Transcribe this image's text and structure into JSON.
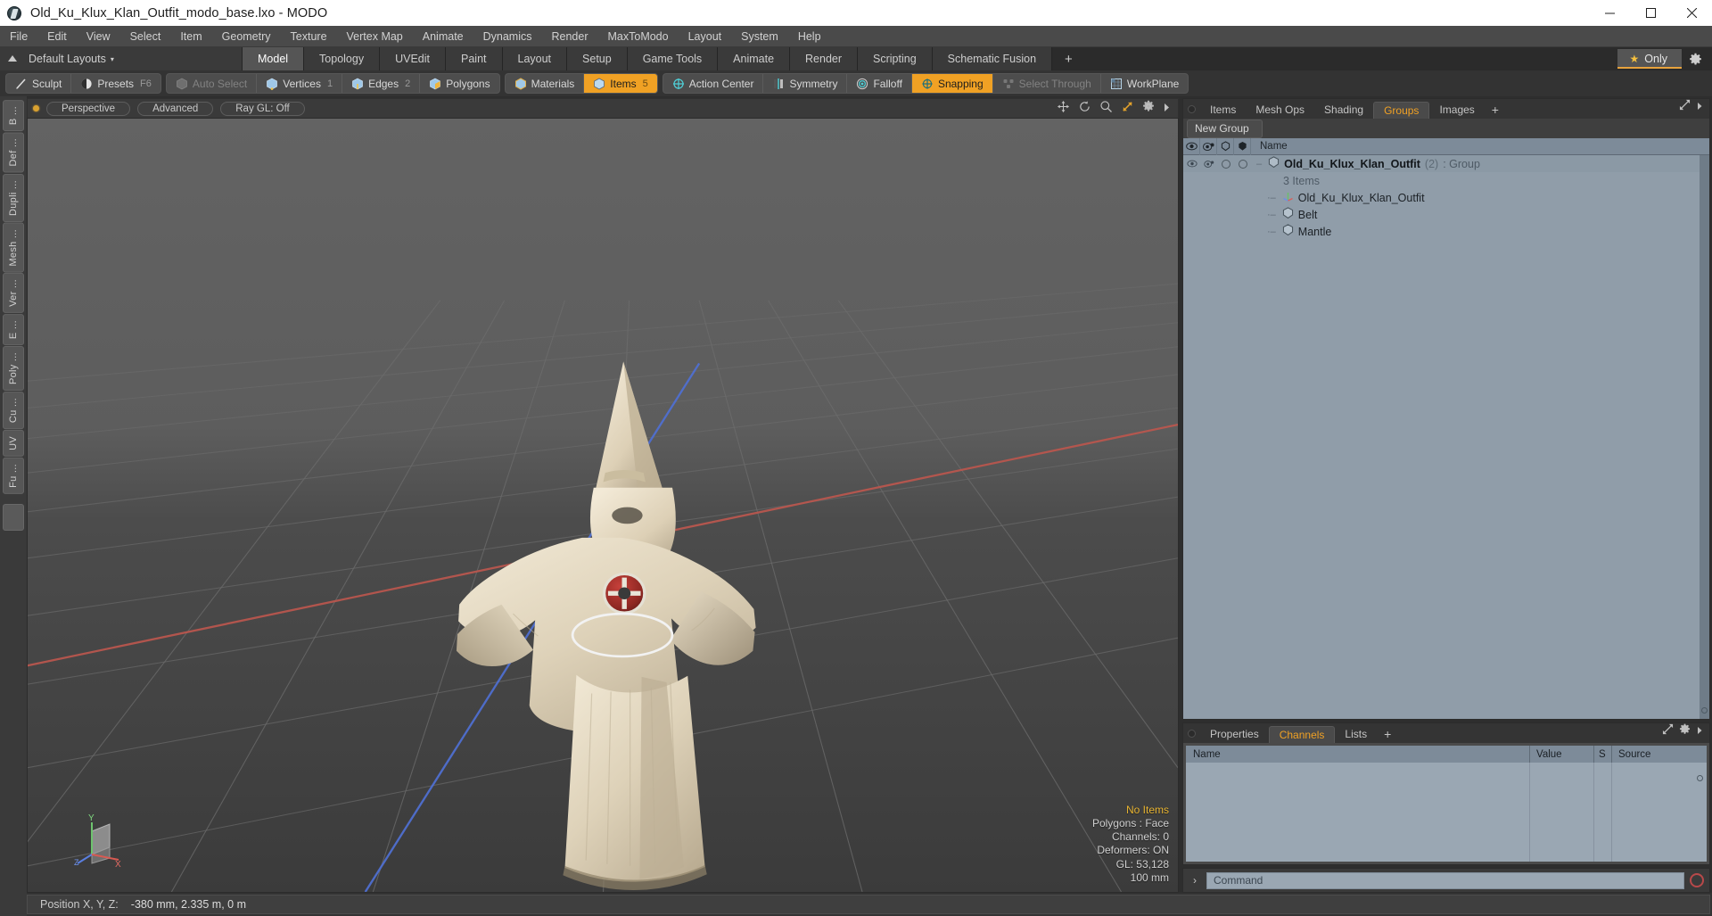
{
  "window": {
    "title": "Old_Ku_Klux_Klan_Outfit_modo_base.lxo - MODO",
    "app_icon": "modo-logo-icon",
    "minimize": "–",
    "maximize": "□",
    "close": "✕"
  },
  "menubar": {
    "items": [
      "File",
      "Edit",
      "View",
      "Select",
      "Item",
      "Geometry",
      "Texture",
      "Vertex Map",
      "Animate",
      "Dynamics",
      "Render",
      "MaxToModo",
      "Layout",
      "System",
      "Help"
    ]
  },
  "layoutbar": {
    "layout_selector": "Default Layouts",
    "caret": "▾",
    "updir_icon": "up-arrow-icon",
    "tabs": [
      {
        "label": "Model",
        "active": true
      },
      {
        "label": "Topology",
        "active": false
      },
      {
        "label": "UVEdit",
        "active": false
      },
      {
        "label": "Paint",
        "active": false
      },
      {
        "label": "Layout",
        "active": false
      },
      {
        "label": "Setup",
        "active": false
      },
      {
        "label": "Game Tools",
        "active": false
      },
      {
        "label": "Animate",
        "active": false
      },
      {
        "label": "Render",
        "active": false
      },
      {
        "label": "Scripting",
        "active": false
      },
      {
        "label": "Schematic Fusion",
        "active": false
      }
    ],
    "add_tab": "+",
    "only_button": "Only",
    "only_star": "★",
    "gear_icon": "gear-icon",
    "accent": "#f0a124"
  },
  "modebar": {
    "groups": [
      {
        "buttons": [
          {
            "label": "Sculpt",
            "icon": "brush-icon",
            "state": "normal",
            "num": ""
          },
          {
            "label": "Presets",
            "icon": "preset-sphere-icon",
            "state": "normal",
            "num": "F6"
          }
        ]
      },
      {
        "buttons": [
          {
            "label": "Auto Select",
            "icon": "cube-gray-icon",
            "state": "disabled",
            "num": ""
          },
          {
            "label": "Vertices",
            "icon": "cube-vertex-icon",
            "state": "normal",
            "num": "1"
          },
          {
            "label": "Edges",
            "icon": "cube-edge-icon",
            "state": "normal",
            "num": "2"
          },
          {
            "label": "Polygons",
            "icon": "cube-poly-icon",
            "state": "normal",
            "num": ""
          }
        ]
      },
      {
        "buttons": [
          {
            "label": "Materials",
            "icon": "cube-material-icon",
            "state": "normal",
            "num": ""
          },
          {
            "label": "Items",
            "icon": "cube-item-icon",
            "state": "active",
            "num": "5"
          }
        ]
      },
      {
        "buttons": [
          {
            "label": "Action Center",
            "icon": "action-center-icon",
            "state": "normal",
            "num": ""
          },
          {
            "label": "Symmetry",
            "icon": "symmetry-icon",
            "state": "normal",
            "num": ""
          },
          {
            "label": "Falloff",
            "icon": "falloff-icon",
            "state": "normal",
            "num": ""
          },
          {
            "label": "Snapping",
            "icon": "snapping-icon",
            "state": "active",
            "num": ""
          },
          {
            "label": "Select Through",
            "icon": "select-through-icon",
            "state": "disabled",
            "num": ""
          },
          {
            "label": "WorkPlane",
            "icon": "workplane-icon",
            "state": "normal",
            "num": ""
          }
        ]
      }
    ]
  },
  "leftstrip": {
    "tabs": [
      "B ...",
      "Def ...",
      "Dupli ...",
      "Mesh ...",
      "Ver ...",
      "E ...",
      "Poly ...",
      "Cu ...",
      "UV",
      "Fu ..."
    ],
    "extra": ""
  },
  "viewport": {
    "indicator": "viewport-active-dot",
    "pills": [
      "Perspective",
      "Advanced",
      "Ray GL: Off"
    ],
    "tools": [
      "move-icon",
      "rotate-icon",
      "zoom-icon",
      "fit-icon",
      "gear-icon",
      "more-icon"
    ],
    "stats": {
      "no_items": "No Items",
      "polygons": "Polygons : Face",
      "channels": "Channels: 0",
      "deformers": "Deformers: ON",
      "gl": "GL: 53,128",
      "scale": "100 mm"
    },
    "gizmo": {
      "y": "Y",
      "x": "X",
      "z": "Z"
    }
  },
  "right_panel": {
    "tabs": [
      {
        "label": "Items",
        "active": false
      },
      {
        "label": "Mesh Ops",
        "active": false
      },
      {
        "label": "Shading",
        "active": false
      },
      {
        "label": "Groups",
        "active": true
      },
      {
        "label": "Images",
        "active": false
      }
    ],
    "add_tab": "+",
    "expand_icon": "expand-icon",
    "more_icon": "chevron-right-icon",
    "new_group_button": "New Group",
    "tree_columns": {
      "eye": "visibility-icon",
      "render": "render-icon",
      "lock1": "select-lock-icon",
      "lock2": "lock-icon",
      "name": "Name"
    },
    "tree_rows": [
      {
        "icon": "group-icon",
        "name": "Old_Ku_Klux_Klan_Outfit",
        "count": "(2)",
        "type": ": Group",
        "bold": true,
        "indent": 0,
        "has_toggles": true
      },
      {
        "icon": "",
        "name": "3 Items",
        "count": "",
        "type": "",
        "bold": false,
        "indent": 1,
        "has_toggles": false
      },
      {
        "icon": "locator-icon",
        "name": "Old_Ku_Klux_Klan_Outfit",
        "count": "",
        "type": "",
        "bold": false,
        "indent": 1,
        "has_toggles": false
      },
      {
        "icon": "mesh-icon",
        "name": "Belt",
        "count": "",
        "type": "",
        "bold": false,
        "indent": 1,
        "has_toggles": false
      },
      {
        "icon": "mesh-icon",
        "name": "Mantle",
        "count": "",
        "type": "",
        "bold": false,
        "indent": 1,
        "has_toggles": false
      }
    ]
  },
  "bottom_panel": {
    "tabs": [
      {
        "label": "Properties",
        "active": false
      },
      {
        "label": "Channels",
        "active": true
      },
      {
        "label": "Lists",
        "active": false
      }
    ],
    "add_tab": "+",
    "expand_icon": "expand-icon",
    "gear_icon": "gear-icon",
    "more_icon": "chevron-right-icon",
    "columns": [
      "Name",
      "Value",
      "S",
      "Source"
    ],
    "rows": []
  },
  "command_bar": {
    "prompt": "›",
    "placeholder": "Command",
    "value": "",
    "record_icon": "record-icon"
  },
  "statusbar": {
    "position_label": "Position X, Y, Z:",
    "position_value": "-380 mm, 2.335 m, 0 m"
  },
  "colors": {
    "accent_orange": "#f0a124",
    "panel_bg": "#3a3a3a",
    "tree_bg": "#909da9",
    "header_blue": "#7d8b99",
    "title_white": "#ffffff"
  }
}
